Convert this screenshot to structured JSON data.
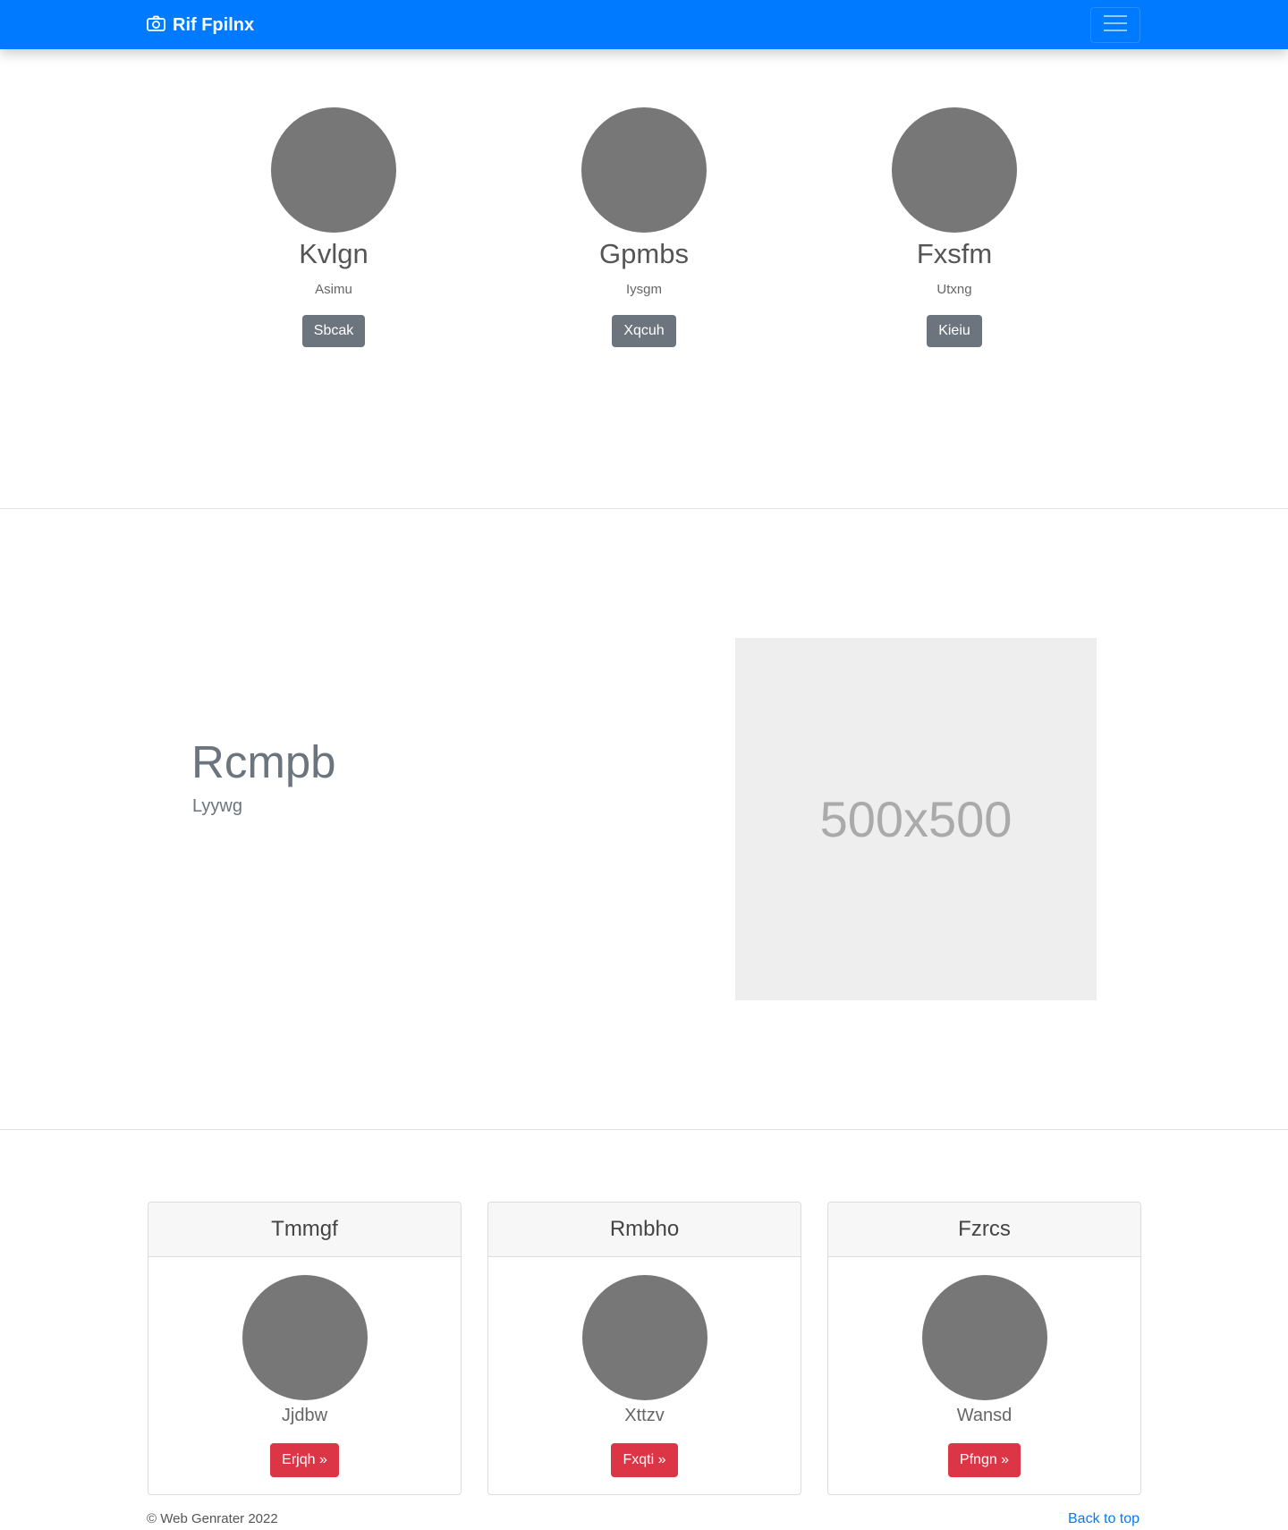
{
  "navbar": {
    "brand": "Rif Fpilnx",
    "brand_icon": "camera-icon",
    "toggle_icon": "menu-icon",
    "color": "#007bff"
  },
  "profiles": [
    {
      "name": "Kvlgn",
      "subtitle": "Asimu",
      "button": "Sbcak"
    },
    {
      "name": "Gpmbs",
      "subtitle": "Iysgm",
      "button": "Xqcuh"
    },
    {
      "name": "Fxsfm",
      "subtitle": "Utxng",
      "button": "Kieiu"
    }
  ],
  "feature": {
    "title": "Rcmpb",
    "subtitle": "Lyywg",
    "image_label": "500x500"
  },
  "cards": [
    {
      "header": "Tmmgf",
      "caption": "Jjdbw",
      "button": "Erjqh »"
    },
    {
      "header": "Rmbho",
      "caption": "Xttzv",
      "button": "Fxqti »"
    },
    {
      "header": "Fzrcs",
      "caption": "Wansd",
      "button": "Pfngn »"
    }
  ],
  "footer": {
    "copyright": "© Web Genrater 2022",
    "back_to_top": "Back to top"
  },
  "colors": {
    "primary": "#007bff",
    "secondary": "#6c757d",
    "danger": "#dc3545",
    "avatar": "#777777"
  }
}
